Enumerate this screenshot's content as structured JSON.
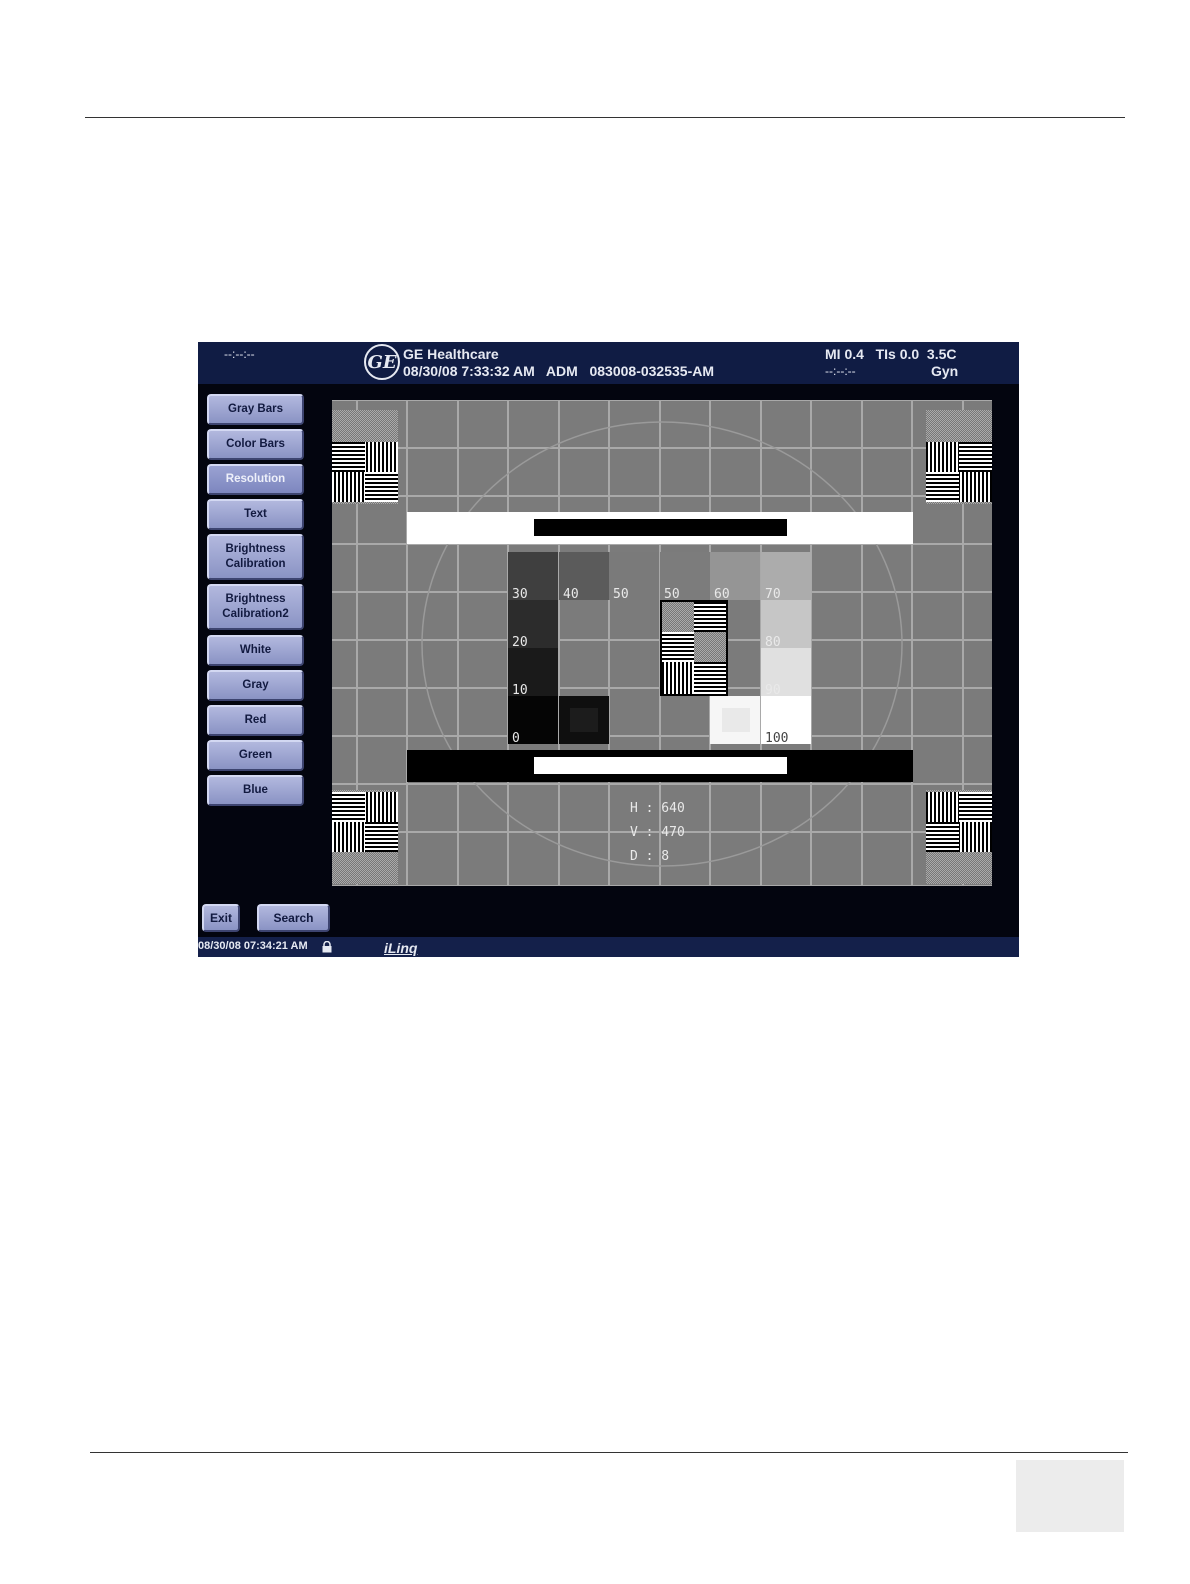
{
  "screen": {
    "header": {
      "left_status": "--:--:--",
      "brand": "GE Healthcare",
      "info_line": "08/30/08 7:33:32 AM   ADM   083008-032535-AM",
      "acoustic_output": "MI 0.4   TIs 0.0  3.5C",
      "right_status": "--:--:--",
      "preset": "Gyn"
    },
    "test_pattern_menu": [
      {
        "label": "Gray Bars",
        "active": false
      },
      {
        "label": "Color Bars",
        "active": false
      },
      {
        "label": "Resolution",
        "active": true
      },
      {
        "label": "Text",
        "active": false
      },
      {
        "label": "Brightness\nCalibration",
        "active": false
      },
      {
        "label": "Brightness\nCalibration2",
        "active": false
      },
      {
        "label": "White",
        "active": false
      },
      {
        "label": "Gray",
        "active": false
      },
      {
        "label": "Red",
        "active": false
      },
      {
        "label": "Green",
        "active": false
      },
      {
        "label": "Blue",
        "active": false
      }
    ],
    "footer_buttons": {
      "exit": "Exit",
      "search": "Search"
    },
    "pattern": {
      "gray_level_labels": {
        "left": [
          "30",
          "20",
          "10",
          "0"
        ],
        "top": [
          "40",
          "50",
          "50",
          "60"
        ],
        "right": [
          "70",
          "80",
          "90",
          "100"
        ]
      },
      "resolution": {
        "h": "H : 640",
        "v": "V : 470",
        "d": "D : 8"
      }
    },
    "statusbar": {
      "datetime": "08/30/08 07:34:21 AM",
      "logo_text": "iLinq",
      "lock_icon": "lock-icon"
    }
  }
}
